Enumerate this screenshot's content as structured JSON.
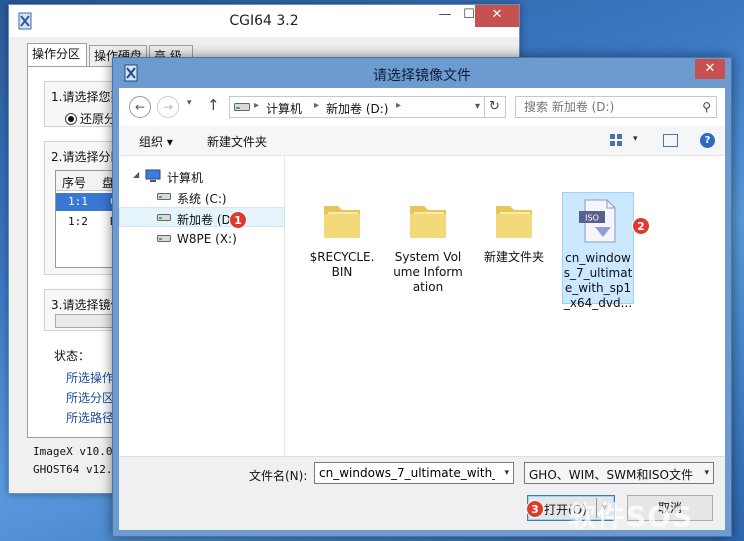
{
  "cgi": {
    "title": "CGI64  3.2",
    "controls": {
      "minimize": "—",
      "maximize": "☐",
      "close": "✕"
    },
    "tabs": [
      {
        "label": "操作分区"
      },
      {
        "label": "操作硬盘"
      },
      {
        "label": "高 级"
      }
    ],
    "group1_title": "1.请选择您要",
    "radio_label": "还原分",
    "group2_title": "2.请选择分区",
    "table": {
      "headers": [
        "序号",
        "盘符"
      ],
      "rows": [
        {
          "index": "1:1",
          "letter": "C:",
          "selected": true
        },
        {
          "index": "1:2",
          "letter": "D:",
          "selected": false
        }
      ]
    },
    "group3_title": "3.请选择镜像",
    "status_title": "状态：",
    "status_lines": [
      "所选操作：",
      "所选分区：",
      "所选路径/"
    ],
    "version1": "ImageX v10.0.",
    "version2": "GHOST64 v12.0"
  },
  "dialog": {
    "title": "请选择镜像文件",
    "close": "✕",
    "nav": {
      "back": "←",
      "forward": "→",
      "recent": "▾",
      "up": "↑",
      "refresh": "↻"
    },
    "address": {
      "seg1": "计算机",
      "seg2": "新加卷 (D:)",
      "sep": "▸",
      "dropdown": "▾"
    },
    "search": {
      "placeholder": "搜索 新加卷 (D:)",
      "icon": "⚲"
    },
    "toolbar": {
      "organize": "组织 ▾",
      "new_folder": "新建文件夹",
      "view_dd": "▾",
      "help": "?"
    },
    "tree": {
      "computer": "计算机",
      "expand": "◢",
      "drives": [
        {
          "label": "系统 (C:)",
          "selected": false
        },
        {
          "label": "新加卷 (D:)",
          "selected": true
        },
        {
          "label": "W8PE (X:)",
          "selected": false
        }
      ]
    },
    "files": [
      {
        "name": "$RECYCLE.BIN",
        "type": "folder",
        "selected": false
      },
      {
        "name": "System Volume Information",
        "type": "folder",
        "selected": false
      },
      {
        "name": "新建文件夹",
        "type": "folder",
        "selected": false
      },
      {
        "name": "cn_windows_7_ultimate_with_sp1_x64_dvd...",
        "type": "iso",
        "selected": true
      }
    ],
    "iso_badge": "ISO",
    "filename_label": "文件名(N):",
    "filename_value": "cn_windows_7_ultimate_with_sp",
    "filetype_value": "GHO、WIM、SWM和ISO文件",
    "open_label": "打开(O)",
    "cancel_label": "取消",
    "dd_glyph": "▾"
  },
  "markers": [
    "1",
    "2",
    "3"
  ],
  "watermark": "软件SOS",
  "colors": {
    "selection": "#cce8ff",
    "marker": "#e03a2f",
    "title_band": "#6d9bcf"
  }
}
